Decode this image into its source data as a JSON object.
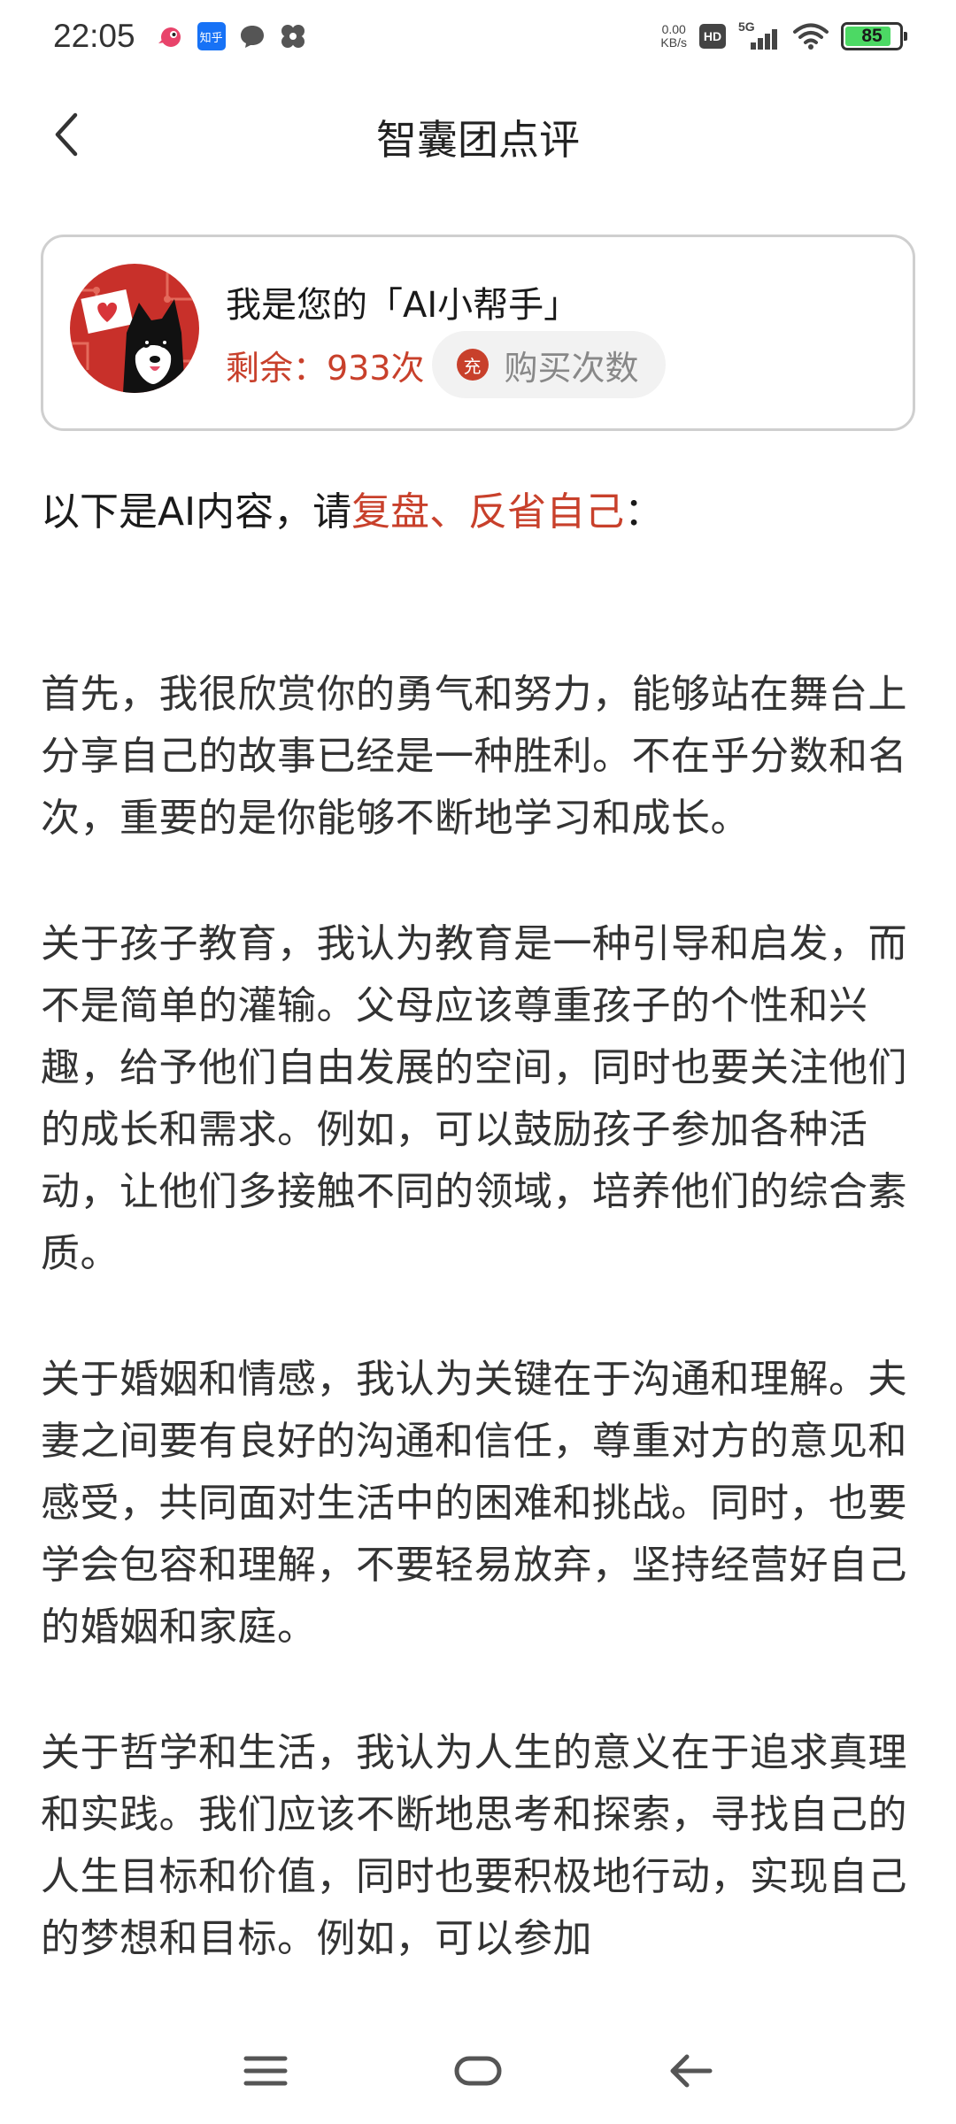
{
  "status_bar": {
    "time": "22:05",
    "zhihu_label": "知乎",
    "net_speed_value": "0.00",
    "net_speed_unit": "KB/s",
    "hd_label": "HD",
    "signal_label": "5G",
    "battery_level": "85",
    "battery_fraction": 0.85
  },
  "header": {
    "title": "智囊团点评"
  },
  "assistant": {
    "name": "我是您的「AI小帮手」",
    "remaining": "剩余：933次",
    "buy_icon_label": "充",
    "buy_label": "购买次数"
  },
  "prompt": {
    "prefix": "以下是AI内容，请",
    "highlight": "复盘、反省自己",
    "suffix": "："
  },
  "content": {
    "paragraphs": [
      "首先，我很欣赏你的勇气和努力，能够站在舞台上分享自己的故事已经是一种胜利。不在乎分数和名次，重要的是你能够不断地学习和成长。",
      "关于孩子教育，我认为教育是一种引导和启发，而不是简单的灌输。父母应该尊重孩子的个性和兴趣，给予他们自由发展的空间，同时也要关注他们的成长和需求。例如，可以鼓励孩子参加各种活动，让他们多接触不同的领域，培养他们的综合素质。",
      "关于婚姻和情感，我认为关键在于沟通和理解。夫妻之间要有良好的沟通和信任，尊重对方的意见和感受，共同面对生活中的困难和挑战。同时，也要学会包容和理解，不要轻易放弃，坚持经营好自己的婚姻和家庭。",
      "关于哲学和生活，我认为人生的意义在于追求真理和实践。我们应该不断地思考和探索，寻找自己的人生目标和价值，同时也要积极地行动，实现自己的梦想和目标。例如，可以参加"
    ]
  },
  "colors": {
    "accent": "#c8402b",
    "battery_green": "#4cd964",
    "card_border": "#cfcfcf",
    "button_bg": "#f2f2f2"
  },
  "icons": {
    "back": "chevron-left-icon",
    "nav_menu": "menu-icon",
    "nav_home": "home-icon",
    "nav_back": "back-arrow-icon"
  }
}
